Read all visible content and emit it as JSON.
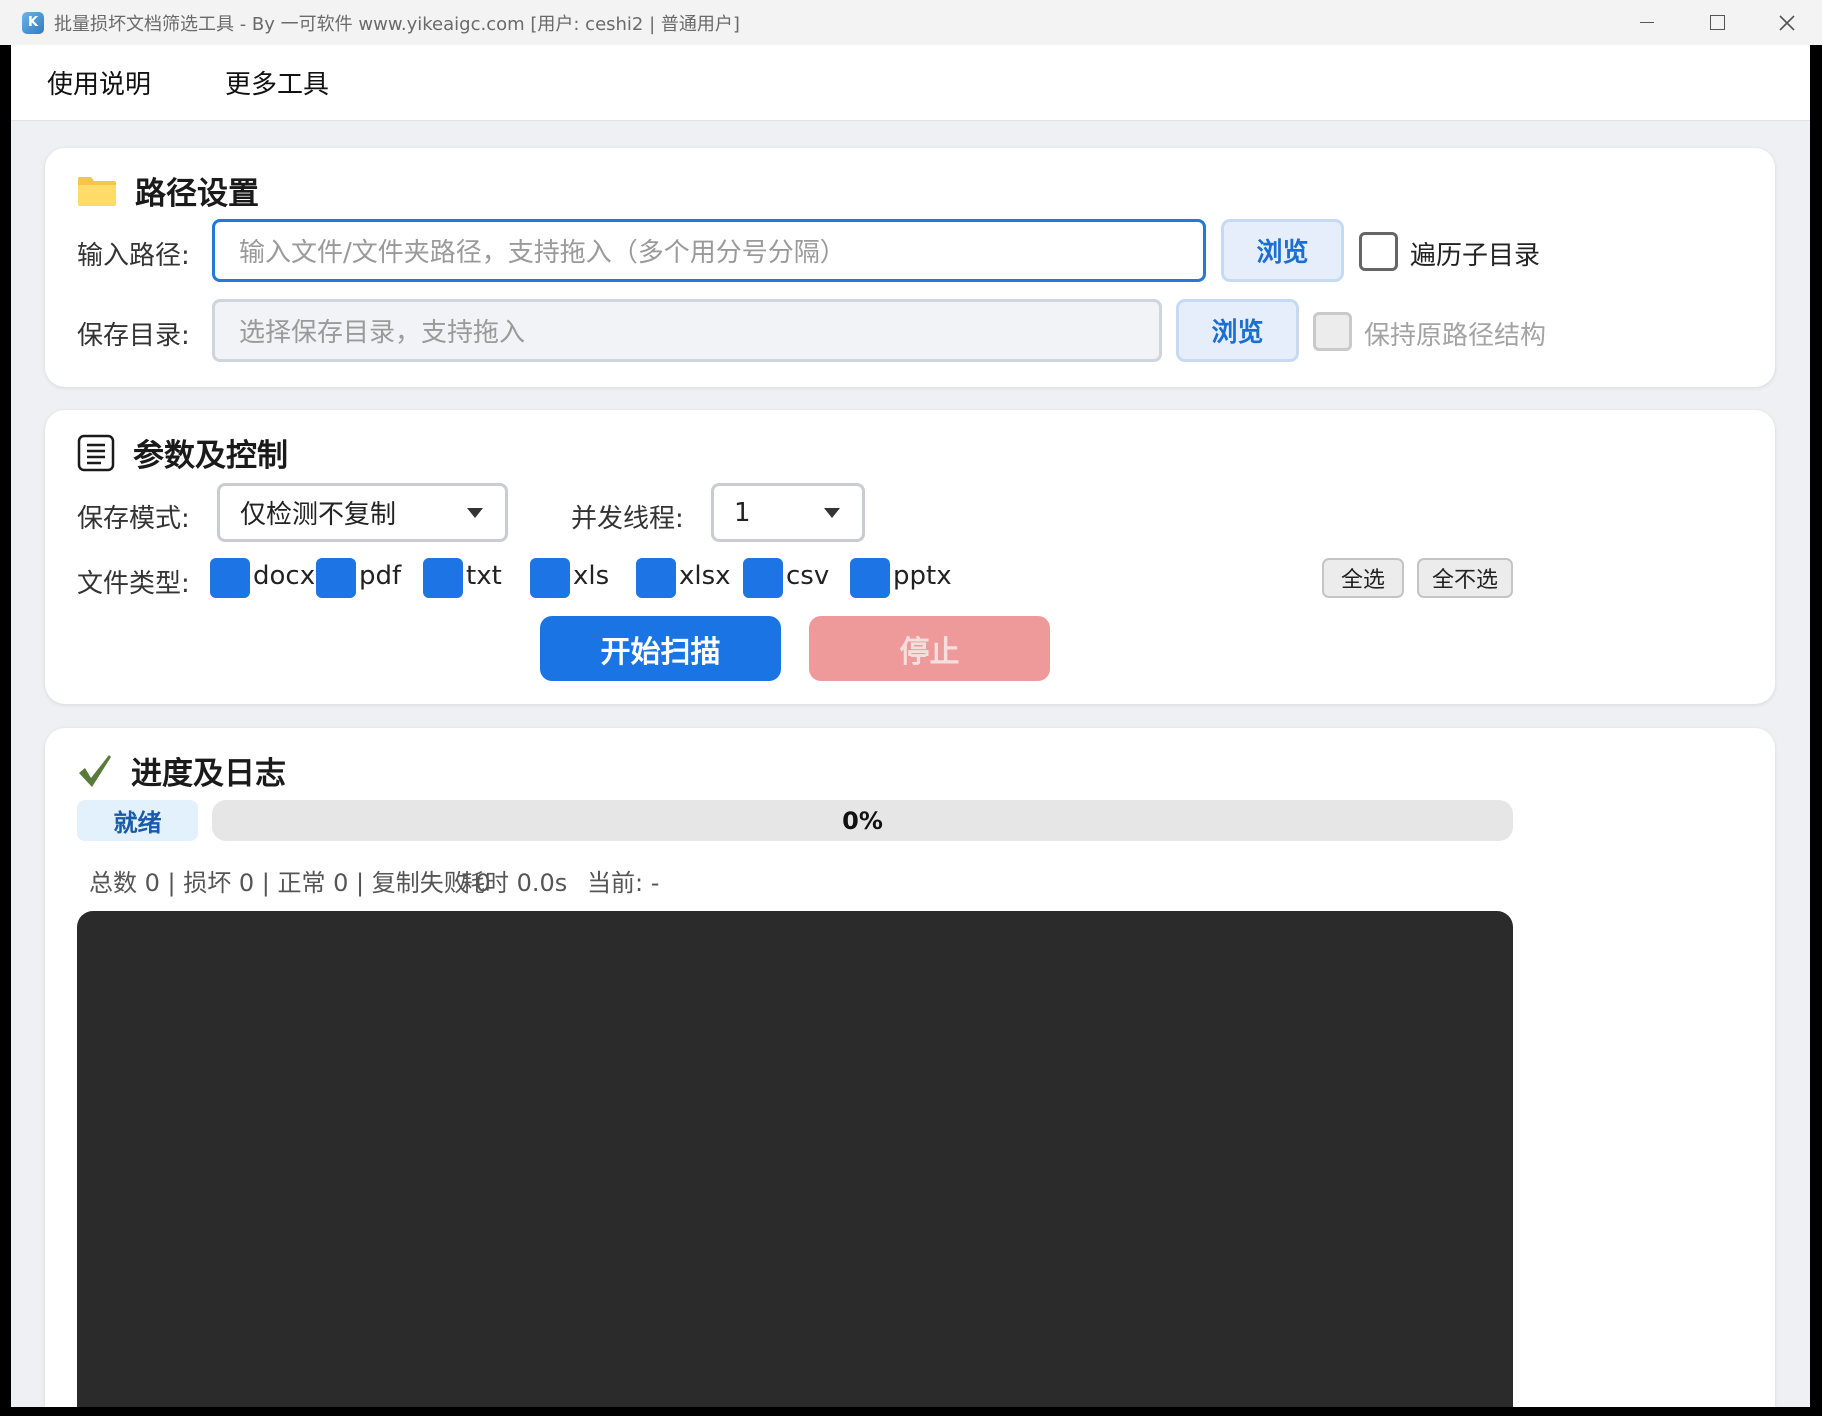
{
  "window": {
    "title": "批量损坏文档筛选工具 - By 一可软件 www.yikeaigc.com  [用户: ceshi2 | 普通用户]",
    "icon": "app-logo-icon"
  },
  "menu": {
    "items": [
      "使用说明",
      "更多工具"
    ]
  },
  "path_section": {
    "title": "路径设置",
    "icon": "folder-icon",
    "input_label": "输入路径:",
    "input_placeholder": "输入文件/文件夹路径，支持拖入（多个用分号分隔）",
    "input_value": "",
    "input_browse": "浏览",
    "recurse_label": "遍历子目录",
    "recurse_checked": false,
    "save_label": "保存目录:",
    "save_placeholder": "选择保存目录，支持拖入",
    "save_value": "",
    "save_browse": "浏览",
    "keep_structure_label": "保持原路径结构",
    "keep_structure_checked": false
  },
  "params_section": {
    "title": "参数及控制",
    "icon": "list-icon",
    "mode_label": "保存模式:",
    "mode_value": "仅检测不复制",
    "threads_label": "并发线程:",
    "threads_value": "1",
    "types_label": "文件类型:",
    "file_types": [
      {
        "name": "docx",
        "checked": true
      },
      {
        "name": "pdf",
        "checked": true
      },
      {
        "name": "txt",
        "checked": true
      },
      {
        "name": "xls",
        "checked": true
      },
      {
        "name": "xlsx",
        "checked": true
      },
      {
        "name": "csv",
        "checked": true
      },
      {
        "name": "pptx",
        "checked": true
      }
    ],
    "select_all": "全选",
    "select_none": "全不选",
    "start": "开始扫描",
    "stop": "停止"
  },
  "progress_section": {
    "title": "进度及日志",
    "icon": "checkmark-icon",
    "status": "就绪",
    "percent_text": "0%",
    "progress_fraction": 0,
    "stats_counts": "总数 0 | 损坏 0 | 正常 0 | 复制失败 0",
    "stats_time": "耗时 0.0s",
    "stats_current": "当前: -"
  },
  "colors": {
    "accent": "#1b74e4",
    "stop_disabled": "#ee9a9a",
    "log_bg": "#2b2b2b",
    "checkmark": "#5a7a3a"
  }
}
